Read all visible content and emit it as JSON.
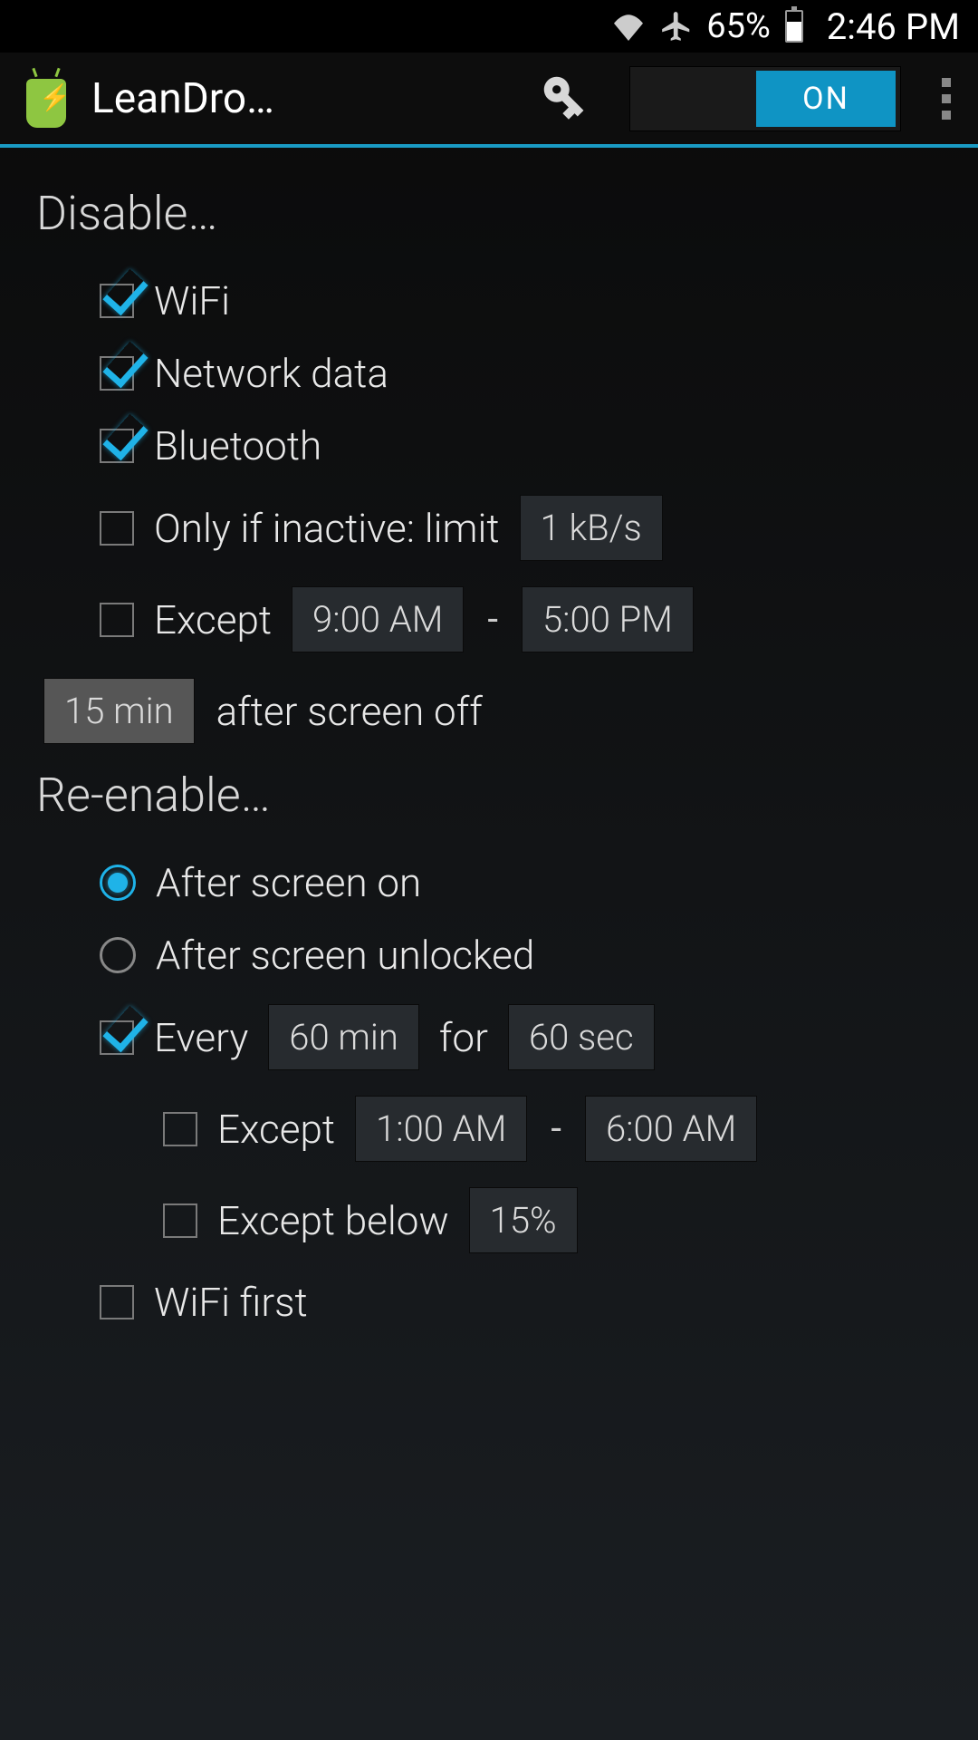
{
  "status_bar": {
    "battery": "65%",
    "time": "2:46 PM"
  },
  "app_bar": {
    "title": "LeanDro…",
    "toggle": "ON"
  },
  "disable": {
    "title": "Disable…",
    "wifi": {
      "label": "WiFi",
      "checked": true
    },
    "network_data": {
      "label": "Network data",
      "checked": true
    },
    "bluetooth": {
      "label": "Bluetooth",
      "checked": true
    },
    "inactive": {
      "label": "Only if inactive: limit",
      "checked": false,
      "value": "1 kB/s"
    },
    "except": {
      "label": "Except",
      "checked": false,
      "from": "9:00 AM",
      "to": "5:00 PM"
    },
    "after": {
      "value": "15 min",
      "label": "after screen off"
    }
  },
  "reenable": {
    "title": "Re-enable…",
    "screen_on": {
      "label": "After screen on",
      "selected": true
    },
    "screen_unlocked": {
      "label": "After screen unlocked",
      "selected": false
    },
    "every": {
      "label_pre": "Every",
      "interval": "60 min",
      "label_mid": "for",
      "duration": "60 sec",
      "checked": true
    },
    "except_time": {
      "label": "Except",
      "checked": false,
      "from": "1:00 AM",
      "to": "6:00 AM"
    },
    "except_below": {
      "label": "Except below",
      "checked": false,
      "value": "15%"
    },
    "wifi_first": {
      "label": "WiFi first",
      "checked": false
    }
  }
}
